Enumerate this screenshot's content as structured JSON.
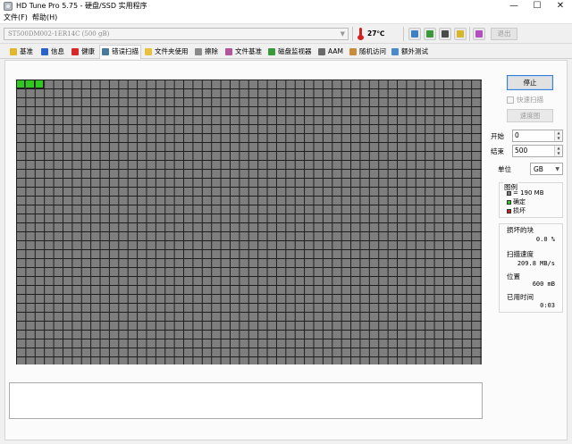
{
  "window": {
    "title": "HD Tune Pro 5.75 - 硬盘/SSD 实用程序",
    "minimize": "—",
    "maximize": "☐",
    "close": "✕"
  },
  "menu": [
    "文件(F)",
    "帮助(H)"
  ],
  "toolbar": {
    "drive": "ST500DM002-1ER14C (500 gB)",
    "temperature": "27℃",
    "exit_label": "退出"
  },
  "tabs": [
    {
      "label": "基准",
      "icon": "benchmark-icon",
      "color": "#e2b72a"
    },
    {
      "label": "信息",
      "icon": "info-icon",
      "color": "#2a62c8"
    },
    {
      "label": "健康",
      "icon": "health-cross-icon",
      "color": "#d62828"
    },
    {
      "label": "错误扫描",
      "icon": "magnifier-icon",
      "color": "#4a7a9a",
      "active": true
    },
    {
      "label": "文件夹使用",
      "icon": "folder-icon",
      "color": "#e8c040"
    },
    {
      "label": "擦除",
      "icon": "erase-icon",
      "color": "#8a8a8a"
    },
    {
      "label": "文件基准",
      "icon": "file-benchmark-icon",
      "color": "#b0569a"
    },
    {
      "label": "磁盘监视器",
      "icon": "monitor-icon",
      "color": "#3a9a3a"
    },
    {
      "label": "AAM",
      "icon": "speaker-icon",
      "color": "#6a6a6a"
    },
    {
      "label": "随机访问",
      "icon": "random-access-icon",
      "color": "#c88c3a"
    },
    {
      "label": "额外测试",
      "icon": "extra-tests-icon",
      "color": "#4a8ac8"
    }
  ],
  "scan": {
    "completed_blocks": 3,
    "colors": {
      "ok": "#2fc81e",
      "pending": "#7e7e7e",
      "bad": "#c81e1e"
    }
  },
  "controls": {
    "stop_label": "停止",
    "quick_scan_label": "快速扫描",
    "quick_scan_checked": false,
    "speed_map_label": "速度图",
    "start_label": "开始",
    "start_value": "0",
    "end_label": "结束",
    "end_value": "500",
    "unit_label": "单位",
    "unit_value": "GB"
  },
  "legend": {
    "title": "图例",
    "block_size": "= 190 MB",
    "ok_label": "确定",
    "bad_label": "损坏"
  },
  "stats": {
    "damaged_label": "损坏的块",
    "damaged_value": "0.0 %",
    "speed_label": "扫描速度",
    "speed_value": "209.8 MB/s",
    "position_label": "位置",
    "position_value": "600 mB",
    "elapsed_label": "已用时间",
    "elapsed_value": "0:03"
  },
  "log": ""
}
